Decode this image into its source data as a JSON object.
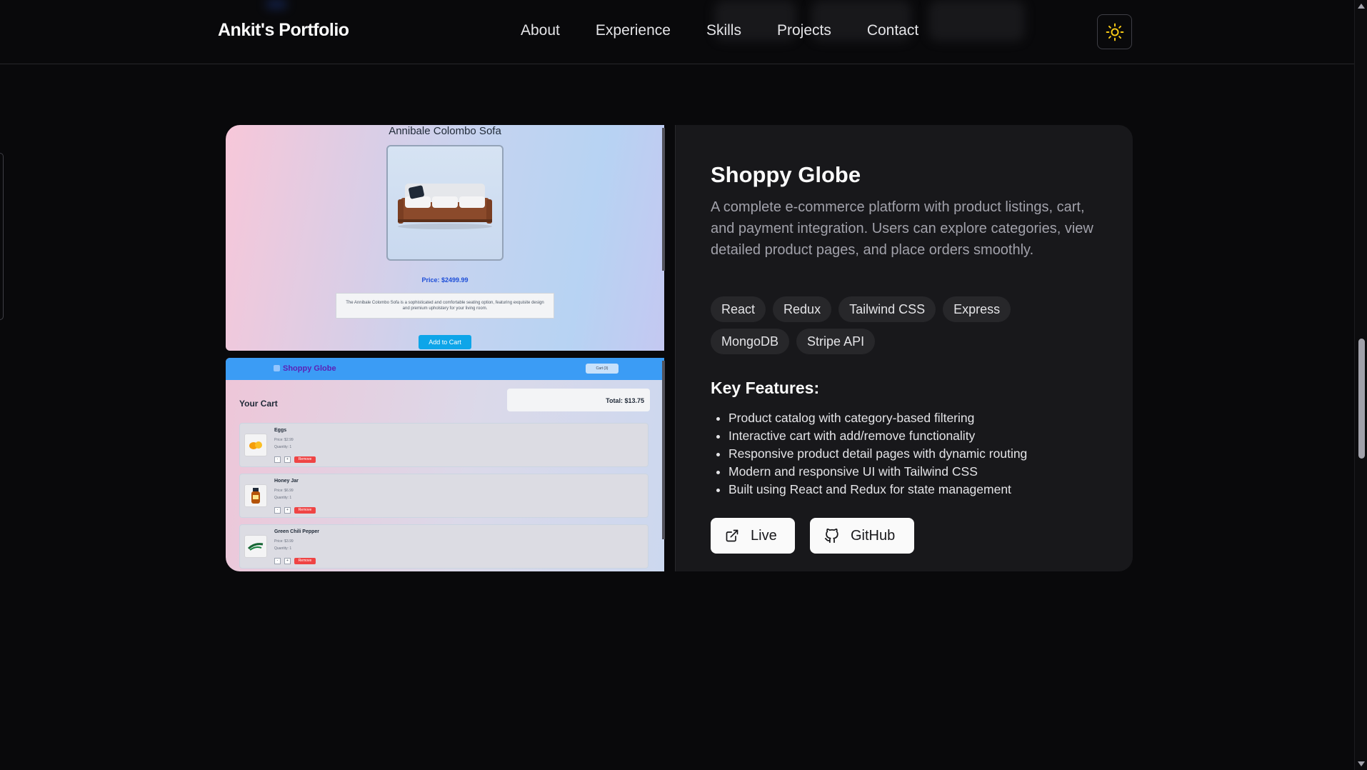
{
  "nav": {
    "brand": "Ankit's Portfolio",
    "links": [
      "About",
      "Experience",
      "Skills",
      "Projects",
      "Contact"
    ],
    "theme_icon": "sun-icon"
  },
  "project": {
    "title": "Shoppy Globe",
    "description": "A complete e-commerce platform with product listings, cart, and payment integration. Users can explore categories, view detailed product pages, and place orders smoothly.",
    "tags": [
      "React",
      "Redux",
      "Tailwind CSS",
      "Express",
      "MongoDB",
      "Stripe API"
    ],
    "features_title": "Key Features:",
    "features": [
      "Product catalog with category-based filtering",
      "Interactive cart with add/remove functionality",
      "Responsive product detail pages with dynamic routing",
      "Modern and responsive UI with Tailwind CSS",
      "Built using React and Redux for state management"
    ],
    "live_label": "Live",
    "github_label": "GitHub"
  },
  "screenshot_product": {
    "title": "Annibale Colombo Sofa",
    "price": "Price: $2499.99",
    "description": "The Annibale Colombo Sofa is a sophisticated and comfortable seating option, featuring exquisite design and premium upholstery for your living room.",
    "button": "Add to Cart"
  },
  "screenshot_cart": {
    "logo": "Shoppy Globe",
    "cart_button": "Cart (3)",
    "heading": "Your Cart",
    "total": "Total: $13.75",
    "items": [
      {
        "name": "Eggs",
        "price": "Price: $2.99",
        "quantity": "Quantity: 1"
      },
      {
        "name": "Honey Jar",
        "price": "Price: $6.99",
        "quantity": "Quantity: 1"
      },
      {
        "name": "Green Chili Pepper",
        "price": "Price: $3.99",
        "quantity": "Quantity: 1"
      }
    ],
    "remove_label": "Remove",
    "minus": "-",
    "plus": "+"
  },
  "colors": {
    "background": "#09090b",
    "card": "#18181b",
    "tag": "#27272a",
    "sun": "#facc15",
    "accent_blue": "#3b9cf5"
  }
}
